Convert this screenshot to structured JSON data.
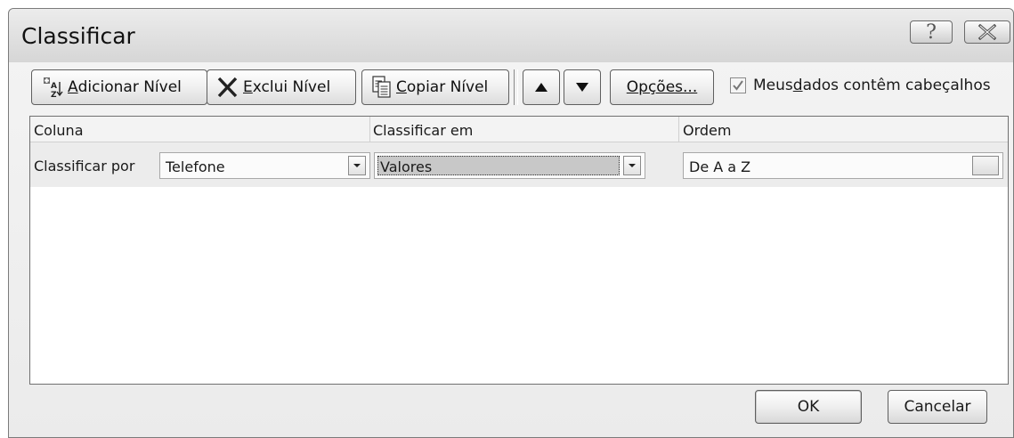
{
  "window": {
    "title": "Classificar",
    "help_label": "?"
  },
  "toolbar": {
    "add_level": {
      "prefix": "",
      "mnemonic": "A",
      "rest": "dicionar Nível"
    },
    "delete_level": {
      "mnemonic": "E",
      "rest": "xclui Nível"
    },
    "copy_level": {
      "mnemonic": "C",
      "rest": "opiar Nível"
    },
    "options": {
      "mnemonic": "O",
      "rest": "pções..."
    },
    "header_checkbox": {
      "before": "Meus ",
      "mnemonic": "d",
      "after": "ados contêm cabeçalhos",
      "checked": true
    }
  },
  "grid": {
    "headers": {
      "column": "Coluna",
      "sort_on": "Classificar em",
      "order": "Ordem"
    },
    "rows": [
      {
        "label": "Classificar por",
        "column": "Telefone",
        "sort_on": "Valores",
        "order": "De A a Z"
      }
    ]
  },
  "footer": {
    "ok_label": "OK",
    "cancel_label": "Cancelar"
  },
  "icons": {
    "add_level": "add-sort-level-icon",
    "delete_level": "delete-x-icon",
    "copy_level": "copy-pages-icon",
    "move_up": "triangle-up-icon",
    "move_down": "triangle-down-icon",
    "combo_arrow": "small-triangle-down-icon",
    "close": "close-x-icon"
  }
}
